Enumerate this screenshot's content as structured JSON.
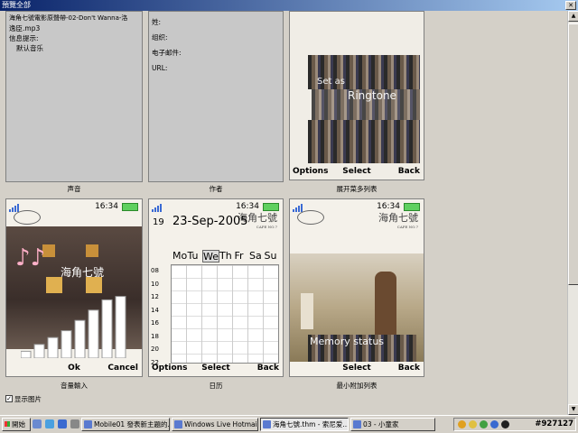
{
  "window": {
    "title": "預覽全部"
  },
  "panels": {
    "sound": {
      "line1": "海角七號電影原聲帶-02-Don't Wanna-洛",
      "line2": "逸臣.mp3",
      "line3": "信息提示:",
      "line4": "默认音乐",
      "caption": "声音"
    },
    "author": {
      "name_label": "姓:",
      "org_label": "组织:",
      "email_label": "电子邮件:",
      "url_label": "URL:",
      "caption": "作者"
    },
    "expand_list": {
      "overlay1": "Set as",
      "overlay2": "Ringtone",
      "softkey_left": "Options",
      "softkey_mid": "Select",
      "softkey_right": "Back",
      "caption": "展开菜多列表"
    }
  },
  "phones": {
    "time": "16:34",
    "brand": "海角七號",
    "brand_sub": "CAPE NO.7",
    "stamp": "POSTMARK",
    "volume": {
      "softkey_mid": "Ok",
      "softkey_right": "Cancel",
      "caption": "音量輸入",
      "levels": [
        0.1,
        0.2,
        0.3,
        0.4,
        0.55,
        0.7,
        0.85,
        0.9
      ]
    },
    "calendar": {
      "day": "19",
      "date": "23-Sep-2005",
      "weekdays": [
        "Mo",
        "Tu",
        "We",
        "Th",
        "Fr",
        "Sa",
        "Su"
      ],
      "hours": [
        "08",
        "10",
        "12",
        "14",
        "16",
        "18",
        "20",
        "22"
      ],
      "softkey_left": "Options",
      "softkey_mid": "Select",
      "softkey_right": "Back",
      "caption": "日历"
    },
    "memory": {
      "overlay": "Memory status",
      "softkey_mid": "Select",
      "softkey_right": "Back",
      "caption": "最小附加列表"
    }
  },
  "show_pictures": {
    "label": "显示图片",
    "checked": "✓"
  },
  "taskbar": {
    "start": "開始",
    "tasks": [
      "Mobile01 發表新主題的...",
      "Windows Live Hotmail -...",
      "海角七號.thm - 索尼爱...",
      "03 - 小童家"
    ],
    "clock": "#927127"
  },
  "colors": {
    "titlebar": "#0a246a",
    "face": "#d4d0c8",
    "accent": "#3a6ad4"
  }
}
